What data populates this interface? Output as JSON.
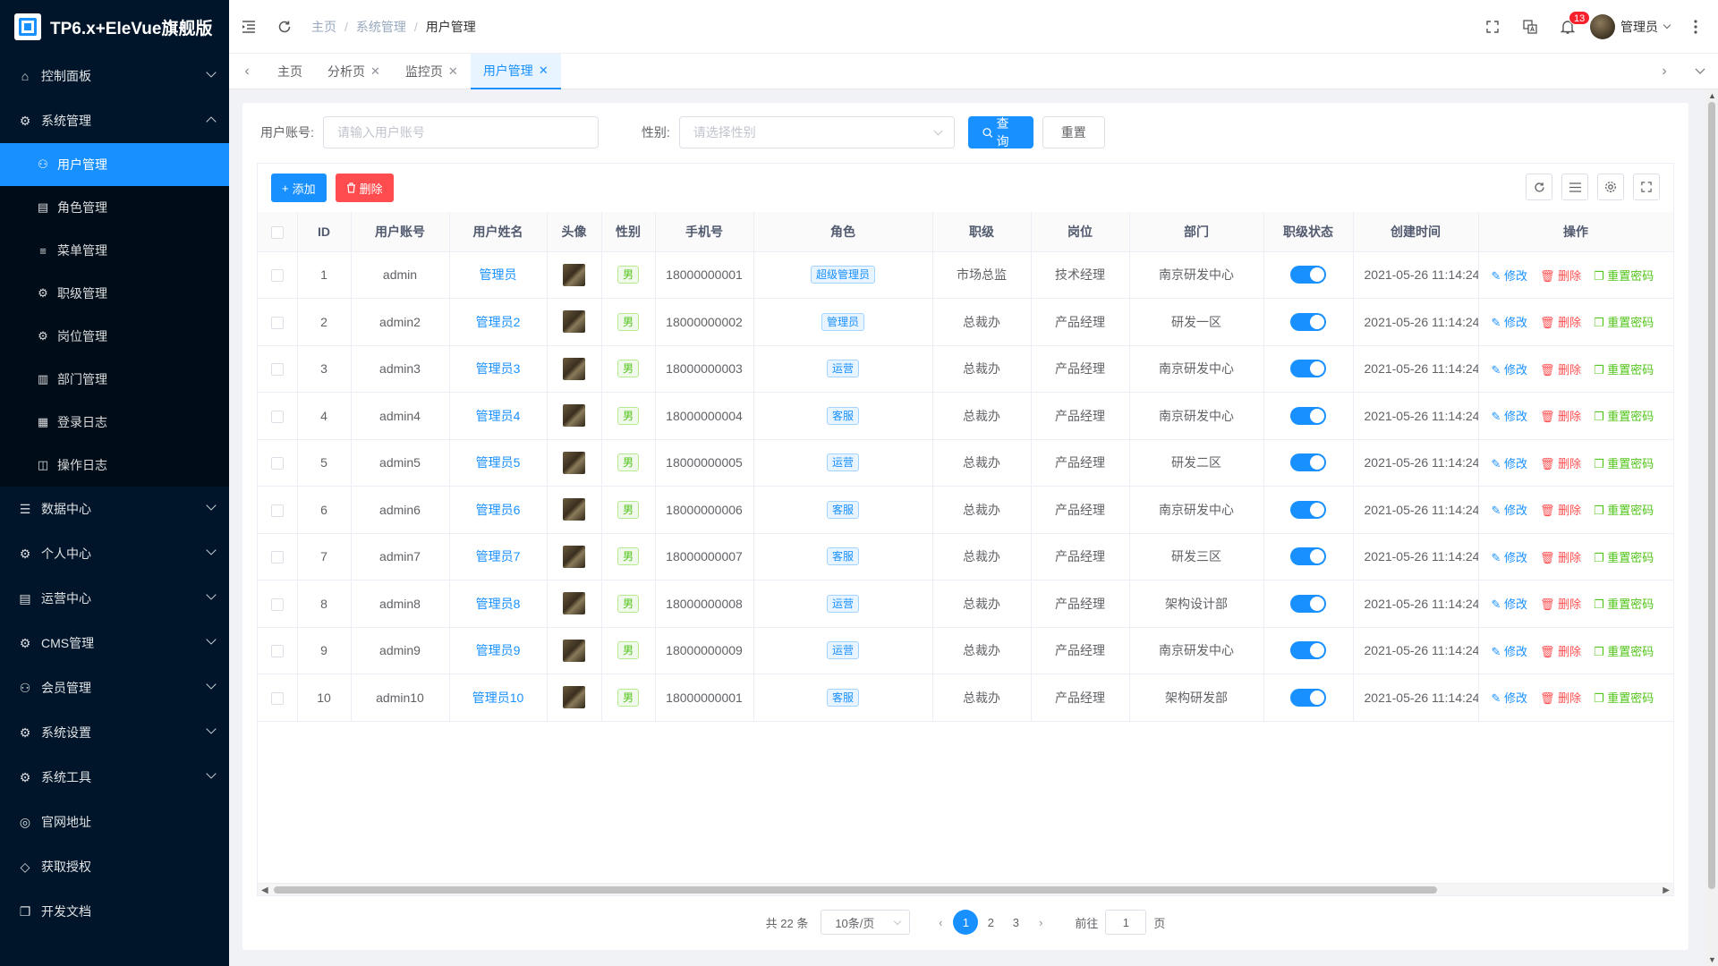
{
  "app": {
    "title": "TP6.x+EleVue旗舰版"
  },
  "sidebar": {
    "items": [
      {
        "label": "控制面板",
        "icon": "home-icon"
      },
      {
        "label": "系统管理",
        "icon": "gear-icon",
        "open": true
      },
      {
        "label": "数据中心",
        "icon": "database-icon"
      },
      {
        "label": "个人中心",
        "icon": "gears-icon"
      },
      {
        "label": "运营中心",
        "icon": "card-icon"
      },
      {
        "label": "CMS管理",
        "icon": "gears-icon"
      },
      {
        "label": "会员管理",
        "icon": "user-icon"
      },
      {
        "label": "系统设置",
        "icon": "gears-icon"
      },
      {
        "label": "系统工具",
        "icon": "gears-icon"
      },
      {
        "label": "官网地址",
        "icon": "globe-icon"
      },
      {
        "label": "获取授权",
        "icon": "diamond-icon"
      },
      {
        "label": "开发文档",
        "icon": "copy-icon"
      }
    ],
    "sub_items": [
      {
        "label": "用户管理",
        "icon": "user-icon",
        "active": true
      },
      {
        "label": "角色管理",
        "icon": "card-icon"
      },
      {
        "label": "菜单管理",
        "icon": "sliders-icon"
      },
      {
        "label": "职级管理",
        "icon": "gear-icon"
      },
      {
        "label": "岗位管理",
        "icon": "gear-icon"
      },
      {
        "label": "部门管理",
        "icon": "building-icon"
      },
      {
        "label": "登录日志",
        "icon": "calendar-icon"
      },
      {
        "label": "操作日志",
        "icon": "layout-icon"
      }
    ]
  },
  "header": {
    "breadcrumb": [
      "主页",
      "系统管理",
      "用户管理"
    ],
    "notification_count": "13",
    "user_name": "管理员"
  },
  "tabs": [
    {
      "label": "主页",
      "closable": false
    },
    {
      "label": "分析页",
      "closable": true
    },
    {
      "label": "监控页",
      "closable": true
    },
    {
      "label": "用户管理",
      "closable": true,
      "active": true
    }
  ],
  "search": {
    "account_label": "用户账号:",
    "account_placeholder": "请输入用户账号",
    "gender_label": "性别:",
    "gender_placeholder": "请选择性别",
    "query_label": "查询",
    "reset_label": "重置"
  },
  "toolbar": {
    "add_label": "添加",
    "delete_label": "删除"
  },
  "table": {
    "columns": [
      "ID",
      "用户账号",
      "用户姓名",
      "头像",
      "性别",
      "手机号",
      "角色",
      "职级",
      "岗位",
      "部门",
      "职级状态",
      "创建时间",
      "操作"
    ],
    "actions": {
      "edit": "修改",
      "delete": "删除",
      "reset": "重置密码"
    },
    "rows": [
      {
        "id": "1",
        "account": "admin",
        "name": "管理员",
        "gender": "男",
        "phone": "18000000001",
        "role": "超级管理员",
        "rank": "市场总监",
        "post": "技术经理",
        "dept": "南京研发中心",
        "status": true,
        "created": "2021-05-26 11:14:24"
      },
      {
        "id": "2",
        "account": "admin2",
        "name": "管理员2",
        "gender": "男",
        "phone": "18000000002",
        "role": "管理员",
        "rank": "总裁办",
        "post": "产品经理",
        "dept": "研发一区",
        "status": true,
        "created": "2021-05-26 11:14:24"
      },
      {
        "id": "3",
        "account": "admin3",
        "name": "管理员3",
        "gender": "男",
        "phone": "18000000003",
        "role": "运营",
        "rank": "总裁办",
        "post": "产品经理",
        "dept": "南京研发中心",
        "status": true,
        "created": "2021-05-26 11:14:24"
      },
      {
        "id": "4",
        "account": "admin4",
        "name": "管理员4",
        "gender": "男",
        "phone": "18000000004",
        "role": "客服",
        "rank": "总裁办",
        "post": "产品经理",
        "dept": "南京研发中心",
        "status": true,
        "created": "2021-05-26 11:14:24"
      },
      {
        "id": "5",
        "account": "admin5",
        "name": "管理员5",
        "gender": "男",
        "phone": "18000000005",
        "role": "运营",
        "rank": "总裁办",
        "post": "产品经理",
        "dept": "研发二区",
        "status": true,
        "created": "2021-05-26 11:14:24"
      },
      {
        "id": "6",
        "account": "admin6",
        "name": "管理员6",
        "gender": "男",
        "phone": "18000000006",
        "role": "客服",
        "rank": "总裁办",
        "post": "产品经理",
        "dept": "南京研发中心",
        "status": true,
        "created": "2021-05-26 11:14:24"
      },
      {
        "id": "7",
        "account": "admin7",
        "name": "管理员7",
        "gender": "男",
        "phone": "18000000007",
        "role": "客服",
        "rank": "总裁办",
        "post": "产品经理",
        "dept": "研发三区",
        "status": true,
        "created": "2021-05-26 11:14:24"
      },
      {
        "id": "8",
        "account": "admin8",
        "name": "管理员8",
        "gender": "男",
        "phone": "18000000008",
        "role": "运营",
        "rank": "总裁办",
        "post": "产品经理",
        "dept": "架构设计部",
        "status": true,
        "created": "2021-05-26 11:14:24"
      },
      {
        "id": "9",
        "account": "admin9",
        "name": "管理员9",
        "gender": "男",
        "phone": "18000000009",
        "role": "运营",
        "rank": "总裁办",
        "post": "产品经理",
        "dept": "南京研发中心",
        "status": true,
        "created": "2021-05-26 11:14:24"
      },
      {
        "id": "10",
        "account": "admin10",
        "name": "管理员10",
        "gender": "男",
        "phone": "18000000001",
        "role": "客服",
        "rank": "总裁办",
        "post": "产品经理",
        "dept": "架构研发部",
        "status": true,
        "created": "2021-05-26 11:14:24"
      }
    ]
  },
  "pagination": {
    "total_text": "共 22 条",
    "page_size": "10条/页",
    "pages": [
      "1",
      "2",
      "3"
    ],
    "current": "1",
    "goto_label": "前往",
    "goto_value": "1",
    "page_unit": "页"
  }
}
